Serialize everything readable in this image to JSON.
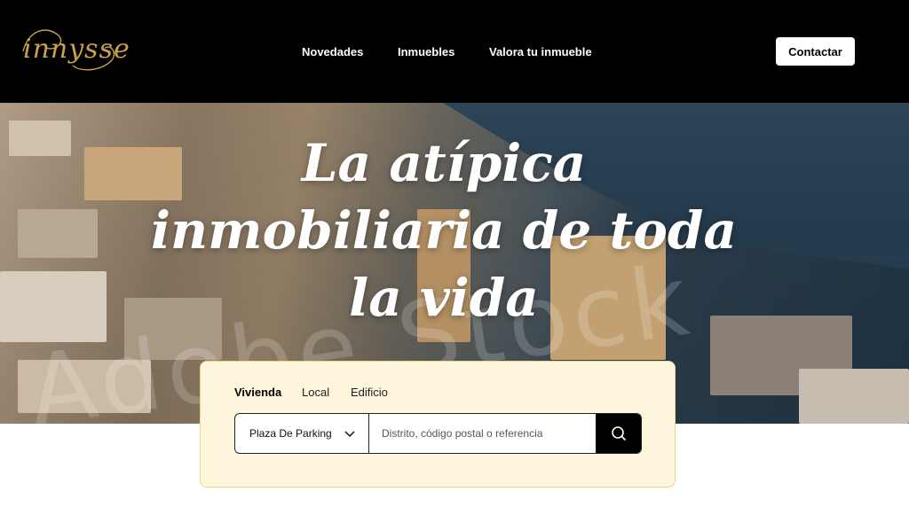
{
  "brand": {
    "logo_text": "innysse",
    "accent": "#c9a24a"
  },
  "nav": {
    "items": [
      {
        "label": "Novedades"
      },
      {
        "label": "Inmuebles"
      },
      {
        "label": "Valora tu inmueble"
      }
    ],
    "contact_label": "Contactar"
  },
  "hero": {
    "title": "La atípica inmobiliaria de toda la vida",
    "watermark": "Adobe Stock"
  },
  "search": {
    "tabs": [
      {
        "label": "Vivienda",
        "active": true
      },
      {
        "label": "Local",
        "active": false
      },
      {
        "label": "Edificio",
        "active": false
      }
    ],
    "select_value": "Plaza De Parking",
    "placeholder": "Distrito, código postal o referencia",
    "icons": {
      "select": "chevron-down-icon",
      "submit": "search-icon"
    },
    "card_bg": "#fdf6dd",
    "card_border": "#ecd58e"
  }
}
